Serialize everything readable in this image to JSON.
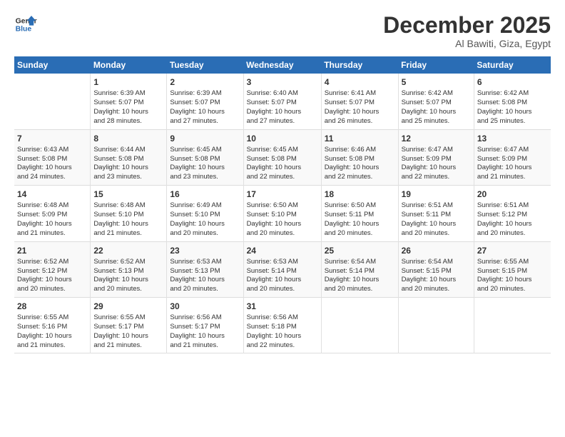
{
  "header": {
    "logo_line1": "General",
    "logo_line2": "Blue",
    "title": "December 2025",
    "subtitle": "Al Bawiti, Giza, Egypt"
  },
  "weekdays": [
    "Sunday",
    "Monday",
    "Tuesday",
    "Wednesday",
    "Thursday",
    "Friday",
    "Saturday"
  ],
  "weeks": [
    [
      {
        "num": "",
        "info": ""
      },
      {
        "num": "1",
        "info": "Sunrise: 6:39 AM\nSunset: 5:07 PM\nDaylight: 10 hours\nand 28 minutes."
      },
      {
        "num": "2",
        "info": "Sunrise: 6:39 AM\nSunset: 5:07 PM\nDaylight: 10 hours\nand 27 minutes."
      },
      {
        "num": "3",
        "info": "Sunrise: 6:40 AM\nSunset: 5:07 PM\nDaylight: 10 hours\nand 27 minutes."
      },
      {
        "num": "4",
        "info": "Sunrise: 6:41 AM\nSunset: 5:07 PM\nDaylight: 10 hours\nand 26 minutes."
      },
      {
        "num": "5",
        "info": "Sunrise: 6:42 AM\nSunset: 5:07 PM\nDaylight: 10 hours\nand 25 minutes."
      },
      {
        "num": "6",
        "info": "Sunrise: 6:42 AM\nSunset: 5:08 PM\nDaylight: 10 hours\nand 25 minutes."
      }
    ],
    [
      {
        "num": "7",
        "info": "Sunrise: 6:43 AM\nSunset: 5:08 PM\nDaylight: 10 hours\nand 24 minutes."
      },
      {
        "num": "8",
        "info": "Sunrise: 6:44 AM\nSunset: 5:08 PM\nDaylight: 10 hours\nand 23 minutes."
      },
      {
        "num": "9",
        "info": "Sunrise: 6:45 AM\nSunset: 5:08 PM\nDaylight: 10 hours\nand 23 minutes."
      },
      {
        "num": "10",
        "info": "Sunrise: 6:45 AM\nSunset: 5:08 PM\nDaylight: 10 hours\nand 22 minutes."
      },
      {
        "num": "11",
        "info": "Sunrise: 6:46 AM\nSunset: 5:08 PM\nDaylight: 10 hours\nand 22 minutes."
      },
      {
        "num": "12",
        "info": "Sunrise: 6:47 AM\nSunset: 5:09 PM\nDaylight: 10 hours\nand 22 minutes."
      },
      {
        "num": "13",
        "info": "Sunrise: 6:47 AM\nSunset: 5:09 PM\nDaylight: 10 hours\nand 21 minutes."
      }
    ],
    [
      {
        "num": "14",
        "info": "Sunrise: 6:48 AM\nSunset: 5:09 PM\nDaylight: 10 hours\nand 21 minutes."
      },
      {
        "num": "15",
        "info": "Sunrise: 6:48 AM\nSunset: 5:10 PM\nDaylight: 10 hours\nand 21 minutes."
      },
      {
        "num": "16",
        "info": "Sunrise: 6:49 AM\nSunset: 5:10 PM\nDaylight: 10 hours\nand 20 minutes."
      },
      {
        "num": "17",
        "info": "Sunrise: 6:50 AM\nSunset: 5:10 PM\nDaylight: 10 hours\nand 20 minutes."
      },
      {
        "num": "18",
        "info": "Sunrise: 6:50 AM\nSunset: 5:11 PM\nDaylight: 10 hours\nand 20 minutes."
      },
      {
        "num": "19",
        "info": "Sunrise: 6:51 AM\nSunset: 5:11 PM\nDaylight: 10 hours\nand 20 minutes."
      },
      {
        "num": "20",
        "info": "Sunrise: 6:51 AM\nSunset: 5:12 PM\nDaylight: 10 hours\nand 20 minutes."
      }
    ],
    [
      {
        "num": "21",
        "info": "Sunrise: 6:52 AM\nSunset: 5:12 PM\nDaylight: 10 hours\nand 20 minutes."
      },
      {
        "num": "22",
        "info": "Sunrise: 6:52 AM\nSunset: 5:13 PM\nDaylight: 10 hours\nand 20 minutes."
      },
      {
        "num": "23",
        "info": "Sunrise: 6:53 AM\nSunset: 5:13 PM\nDaylight: 10 hours\nand 20 minutes."
      },
      {
        "num": "24",
        "info": "Sunrise: 6:53 AM\nSunset: 5:14 PM\nDaylight: 10 hours\nand 20 minutes."
      },
      {
        "num": "25",
        "info": "Sunrise: 6:54 AM\nSunset: 5:14 PM\nDaylight: 10 hours\nand 20 minutes."
      },
      {
        "num": "26",
        "info": "Sunrise: 6:54 AM\nSunset: 5:15 PM\nDaylight: 10 hours\nand 20 minutes."
      },
      {
        "num": "27",
        "info": "Sunrise: 6:55 AM\nSunset: 5:15 PM\nDaylight: 10 hours\nand 20 minutes."
      }
    ],
    [
      {
        "num": "28",
        "info": "Sunrise: 6:55 AM\nSunset: 5:16 PM\nDaylight: 10 hours\nand 21 minutes."
      },
      {
        "num": "29",
        "info": "Sunrise: 6:55 AM\nSunset: 5:17 PM\nDaylight: 10 hours\nand 21 minutes."
      },
      {
        "num": "30",
        "info": "Sunrise: 6:56 AM\nSunset: 5:17 PM\nDaylight: 10 hours\nand 21 minutes."
      },
      {
        "num": "31",
        "info": "Sunrise: 6:56 AM\nSunset: 5:18 PM\nDaylight: 10 hours\nand 22 minutes."
      },
      {
        "num": "",
        "info": ""
      },
      {
        "num": "",
        "info": ""
      },
      {
        "num": "",
        "info": ""
      }
    ]
  ]
}
